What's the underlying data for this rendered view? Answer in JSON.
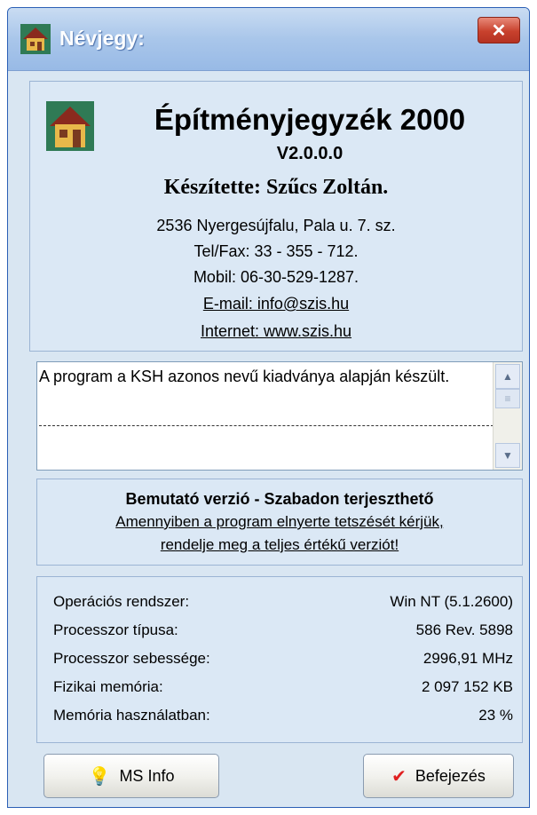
{
  "window": {
    "title": "Névjegy:",
    "close_glyph": "✕"
  },
  "about": {
    "app_name": "Építményjegyzék 2000",
    "version": "V2.0.0.0",
    "author": "Készítette: Szűcs Zoltán.",
    "address": "2536 Nyergesújfalu, Pala u. 7. sz.",
    "telfax": "Tel/Fax: 33 - 355 - 712.",
    "mobile": "Mobil: 06-30-529-1287.",
    "email": "E-mail: info@szis.hu",
    "internet": "Internet: www.szis.hu",
    "icon": "house-icon"
  },
  "notes": {
    "text": "A program a KSH azonos nevű kiadványa alapján készült."
  },
  "demo": {
    "title": "Bemutató verzió - Szabadon terjeszthető",
    "line1": "Amennyiben a program elnyerte tetszését kérjük,",
    "line2": "rendelje meg a teljes értékű verziót!"
  },
  "system": {
    "rows": [
      {
        "label": "Operációs rendszer:",
        "value": "Win NT  (5.1.2600)"
      },
      {
        "label": "Processzor típusa:",
        "value": "586  Rev. 5898"
      },
      {
        "label": "Processzor sebessége:",
        "value": "2996,91 MHz"
      },
      {
        "label": "Fizikai memória:",
        "value": "2 097 152 KB"
      },
      {
        "label": "Memória használatban:",
        "value": "23 %"
      }
    ]
  },
  "buttons": {
    "msinfo": {
      "label": "MS Info",
      "icon": "lightbulb-icon",
      "glyph": "💡"
    },
    "exit": {
      "label": "Befejezés",
      "icon": "checkmark-icon",
      "glyph": "✔"
    }
  },
  "colors": {
    "title_bar": "#a9c6ea",
    "panel": "#dbe8f5",
    "close": "#c8412d",
    "check": "#e02020"
  }
}
